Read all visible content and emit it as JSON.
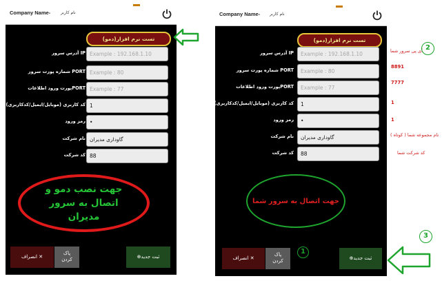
{
  "left_screen": {
    "topbar": {
      "company": "Company Name-",
      "user": "نام کاربر"
    },
    "demo_button": "تست نرم افزار(دمو)",
    "fields": [
      {
        "label": "آدرس سرور IP",
        "value": "Example : 192.168.1.10",
        "placeholder": true
      },
      {
        "label": "شماره پورت سرور PORT",
        "value": "Example : 80",
        "placeholder": true
      },
      {
        "label": "پورت ورود اطلاعاتPORT",
        "value": "Example : 77",
        "placeholder": true
      },
      {
        "label": "کد کاربری (موبایل/ایمیل/کدکاربری)",
        "value": "1",
        "placeholder": false
      },
      {
        "label": "رمز ورود",
        "value": "•",
        "placeholder": false
      },
      {
        "label": "نام شرکت",
        "value": "گاوداری مدیران",
        "placeholder": false
      },
      {
        "label": "کد شرکت",
        "value": "88",
        "placeholder": false
      }
    ],
    "buttons": {
      "cancel": "انصراف ✕",
      "clear_line1": "پاک",
      "clear_line2": "کردن",
      "new": "⊕ثبت جدید"
    },
    "note": "جهت نصب دمو و اتصال به سرور مدیران"
  },
  "right_screen": {
    "topbar": {
      "company": "Company Name-",
      "user": "نام کاربر"
    },
    "demo_button": "تست نرم افزار(دمو)",
    "fields": [
      {
        "label": "آدرس سرور IP",
        "value": "Example : 192.168.1.10",
        "placeholder": true
      },
      {
        "label": "شماره پورت سرور PORT",
        "value": "Example : 80",
        "placeholder": true
      },
      {
        "label": "پورت ورود اطلاعاتPORT",
        "value": "Example : 77",
        "placeholder": true
      },
      {
        "label": "کد کاربری (موبایل/ایمیل/کدکاربری)",
        "value": "1",
        "placeholder": false
      },
      {
        "label": "رمز ورود",
        "value": "•",
        "placeholder": false
      },
      {
        "label": "نام شرکت",
        "value": "گاوداری مدیران",
        "placeholder": false
      },
      {
        "label": "کد شرکت",
        "value": "88",
        "placeholder": false
      }
    ],
    "buttons": {
      "cancel": "انصراف ✕",
      "clear_line1": "پاک",
      "clear_line2": "کردن",
      "new": "⊕ثبت جدید"
    },
    "note": "جهت اتصال به سرور شما"
  },
  "annotations": {
    "ip": "آی پی سرور شما",
    "port": "8891",
    "data_port": "7777",
    "user_code": "1",
    "password": "1",
    "company_name": "نام مجموعه شما ( کوتاه )",
    "company_code": "کد شرکت شما"
  },
  "markers": {
    "one": "1",
    "two": "2",
    "three": "3"
  },
  "colors": {
    "demo_bg": "#7a1010",
    "demo_border": "#e8c63a",
    "annotation_red": "#d01818",
    "marker_green": "#1ba42b"
  }
}
